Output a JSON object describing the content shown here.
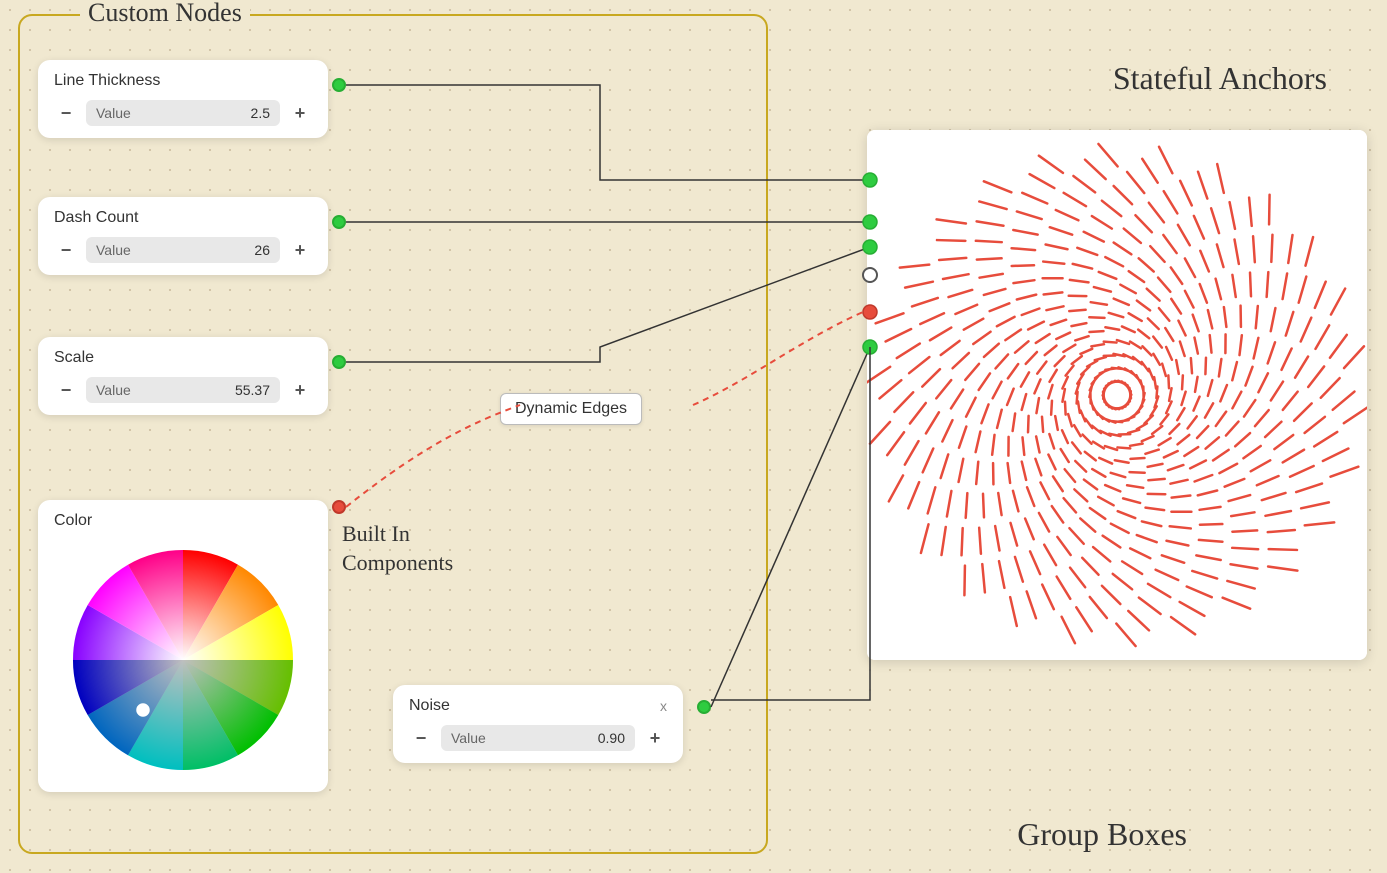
{
  "panelTitle": "Custom Nodes",
  "statefulLabel": "Stateful Anchors",
  "groupBoxesLabel": "Group Boxes",
  "nodes": {
    "lineThickness": {
      "title": "Line Thickness",
      "inputLabel": "Value",
      "value": "2.5",
      "minusLabel": "−",
      "plusLabel": "+"
    },
    "dashCount": {
      "title": "Dash Count",
      "inputLabel": "Value",
      "value": "26",
      "minusLabel": "−",
      "plusLabel": "+"
    },
    "scale": {
      "title": "Scale",
      "inputLabel": "Value",
      "value": "55.37",
      "minusLabel": "−",
      "plusLabel": "+"
    },
    "color": {
      "title": "Color"
    },
    "noise": {
      "title": "Noise",
      "closeLabel": "x",
      "inputLabel": "Value",
      "value": "0.90",
      "minusLabel": "−",
      "plusLabel": "+"
    }
  },
  "dynamicEdgesLabel": "Dynamic Edges",
  "builtInLabel": "Built In\nComponents",
  "colors": {
    "greenDot": "#2ecc40",
    "redDot": "#e74c3c",
    "panelBorder": "#c8a820",
    "background": "#f0e8d0",
    "edgeRed": "#e74c3c"
  }
}
